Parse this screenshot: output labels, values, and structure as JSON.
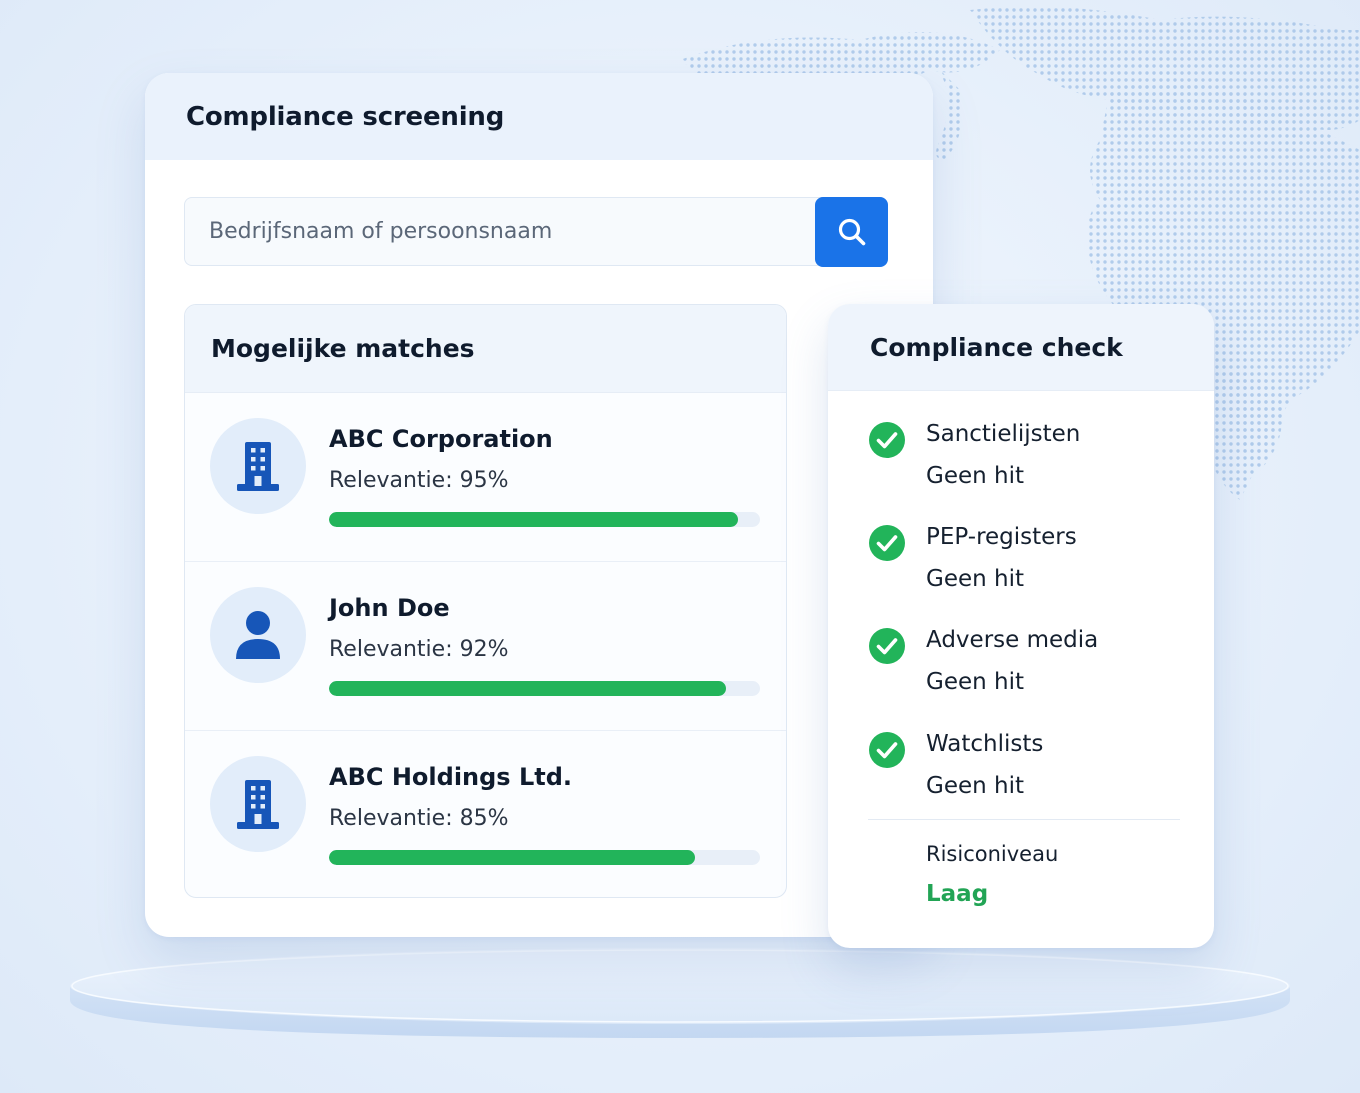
{
  "theme": {
    "accent": "#1a73e8",
    "success": "#22b45a",
    "risk_low": "#22a455",
    "icon_blue": "#1756b8"
  },
  "screening": {
    "title": "Compliance screening",
    "search_placeholder": "Bedrijfsnaam of persoonsnaam",
    "search_icon": "search-icon"
  },
  "matches": {
    "title": "Mogelijke matches",
    "items": [
      {
        "name": "ABC Corporation",
        "relevance_text": "Relevantie: 95%",
        "relevance": 0.95,
        "icon": "building-icon"
      },
      {
        "name": "John Doe",
        "relevance_text": "Relevantie: 92%",
        "relevance": 0.92,
        "icon": "person-icon"
      },
      {
        "name": "ABC Holdings Ltd.",
        "relevance_text": "Relevantie: 85%",
        "relevance": 0.85,
        "icon": "building-icon"
      }
    ]
  },
  "check": {
    "title": "Compliance check",
    "items": [
      {
        "label": "Sanctielijsten",
        "status": "Geen hit",
        "icon": "check-circle-icon"
      },
      {
        "label": "PEP-registers",
        "status": "Geen hit",
        "icon": "check-circle-icon"
      },
      {
        "label": "Adverse media",
        "status": "Geen hit",
        "icon": "check-circle-icon"
      },
      {
        "label": "Watchlists",
        "status": "Geen hit",
        "icon": "check-circle-icon"
      }
    ],
    "risk_label": "Risiconiveau",
    "risk_value": "Laag"
  }
}
